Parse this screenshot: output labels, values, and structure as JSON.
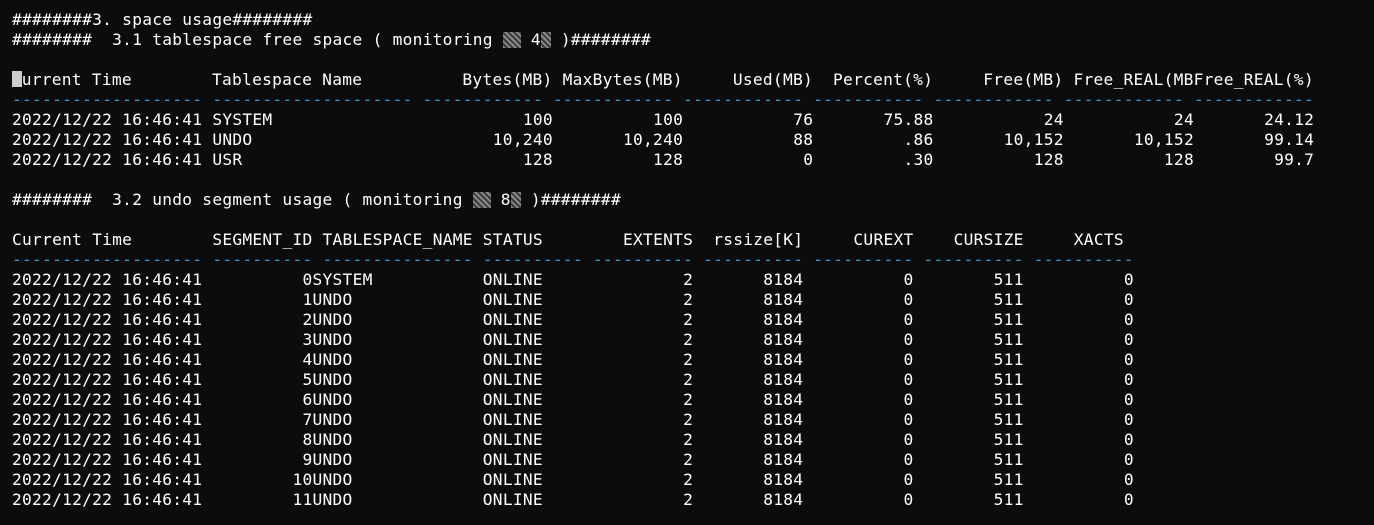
{
  "section_title": "########3. space usage########",
  "ts": {
    "heading_prefix": "########  3.1 tablespace free space ( monitoring ",
    "heading_num": "4",
    "heading_suffix": " )########",
    "columns": [
      "Current Time",
      "Tablespace Name",
      "Bytes(MB)",
      "MaxBytes(MB)",
      "Used(MB)",
      "Percent(%)",
      "Free(MB)",
      "Free_REAL(MB",
      "Free_REAL(%)"
    ],
    "dash_line": "------------------- -------------------- ------------ ------------ ------------ ----------- ------------ ------------ ------------",
    "rows": [
      [
        "2022/12/22 16:46:41",
        "SYSTEM",
        "100",
        "100",
        "76",
        "75.88",
        "24",
        "24",
        "24.12"
      ],
      [
        "2022/12/22 16:46:41",
        "UNDO",
        "10,240",
        "10,240",
        "88",
        ".86",
        "10,152",
        "10,152",
        "99.14"
      ],
      [
        "2022/12/22 16:46:41",
        "USR",
        "128",
        "128",
        "0",
        ".30",
        "128",
        "128",
        "99.7"
      ]
    ]
  },
  "undo": {
    "heading_prefix": "########  3.2 undo segment usage ( monitoring ",
    "heading_num": "8",
    "heading_suffix": " )########",
    "columns": [
      "Current Time",
      "SEGMENT_ID",
      "TABLESPACE_NAME",
      "STATUS",
      "EXTENTS",
      "rssize[K]",
      "CUREXT",
      "CURSIZE",
      "XACTS"
    ],
    "dash_line": "------------------- ---------- --------------- ---------- ---------- ---------- ---------- ---------- ----------",
    "rows": [
      [
        "2022/12/22 16:46:41",
        "0",
        "SYSTEM",
        "ONLINE",
        "2",
        "8184",
        "0",
        "511",
        "0"
      ],
      [
        "2022/12/22 16:46:41",
        "1",
        "UNDO",
        "ONLINE",
        "2",
        "8184",
        "0",
        "511",
        "0"
      ],
      [
        "2022/12/22 16:46:41",
        "2",
        "UNDO",
        "ONLINE",
        "2",
        "8184",
        "0",
        "511",
        "0"
      ],
      [
        "2022/12/22 16:46:41",
        "3",
        "UNDO",
        "ONLINE",
        "2",
        "8184",
        "0",
        "511",
        "0"
      ],
      [
        "2022/12/22 16:46:41",
        "4",
        "UNDO",
        "ONLINE",
        "2",
        "8184",
        "0",
        "511",
        "0"
      ],
      [
        "2022/12/22 16:46:41",
        "5",
        "UNDO",
        "ONLINE",
        "2",
        "8184",
        "0",
        "511",
        "0"
      ],
      [
        "2022/12/22 16:46:41",
        "6",
        "UNDO",
        "ONLINE",
        "2",
        "8184",
        "0",
        "511",
        "0"
      ],
      [
        "2022/12/22 16:46:41",
        "7",
        "UNDO",
        "ONLINE",
        "2",
        "8184",
        "0",
        "511",
        "0"
      ],
      [
        "2022/12/22 16:46:41",
        "8",
        "UNDO",
        "ONLINE",
        "2",
        "8184",
        "0",
        "511",
        "0"
      ],
      [
        "2022/12/22 16:46:41",
        "9",
        "UNDO",
        "ONLINE",
        "2",
        "8184",
        "0",
        "511",
        "0"
      ],
      [
        "2022/12/22 16:46:41",
        "10",
        "UNDO",
        "ONLINE",
        "2",
        "8184",
        "0",
        "511",
        "0"
      ],
      [
        "2022/12/22 16:46:41",
        "11",
        "UNDO",
        "ONLINE",
        "2",
        "8184",
        "0",
        "511",
        "0"
      ]
    ]
  }
}
